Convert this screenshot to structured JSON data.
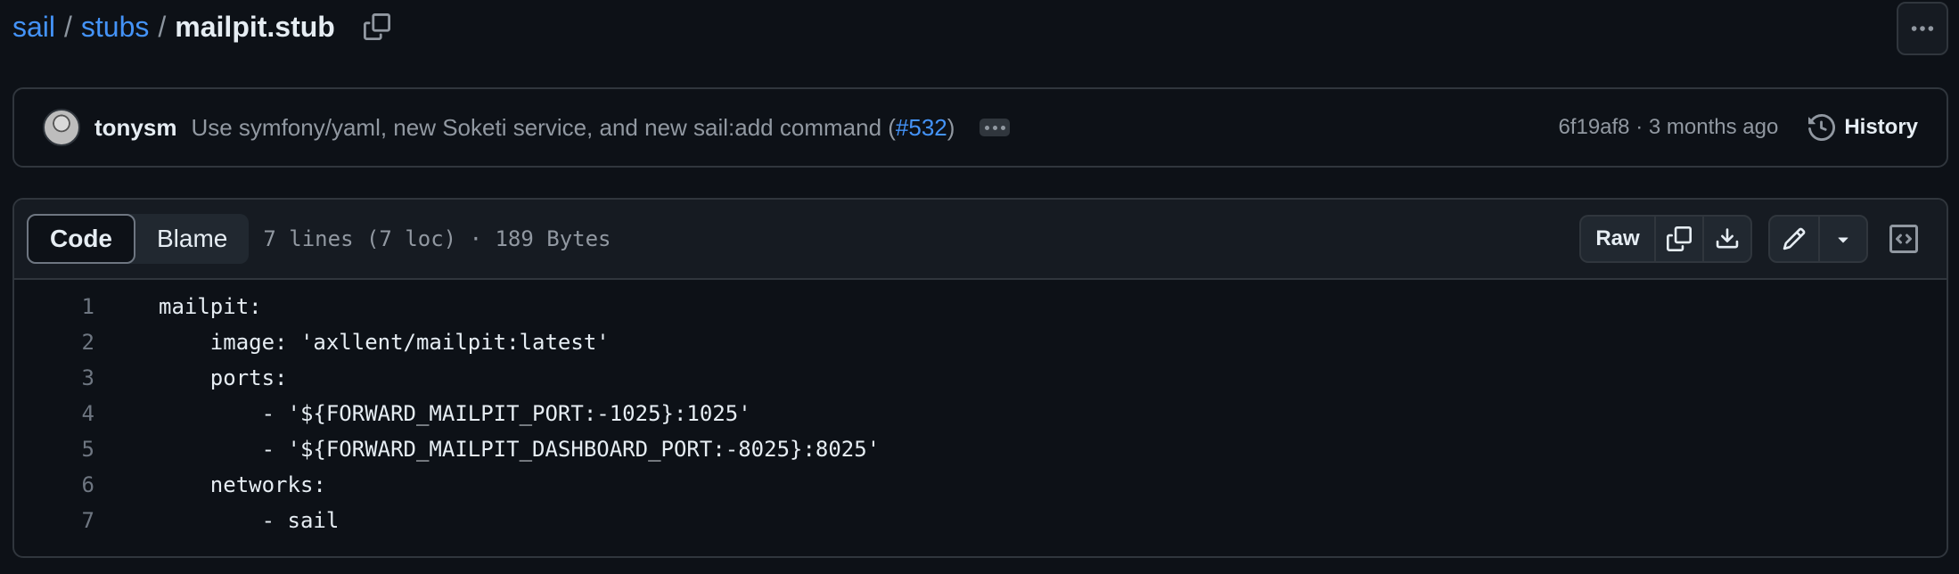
{
  "breadcrumb": {
    "parts": [
      "sail",
      "stubs"
    ],
    "separator": "/",
    "current": "mailpit.stub"
  },
  "commit": {
    "author": "tonysm",
    "message_prefix": "Use symfony/yaml, new Soketi service, and new sail:add command (",
    "pr_number": "#532",
    "message_suffix": ")",
    "sha": "6f19af8",
    "dot": "·",
    "relative_time": "3 months ago",
    "history_label": "History"
  },
  "file_header": {
    "tabs": [
      {
        "label": "Code",
        "active": true
      },
      {
        "label": "Blame",
        "active": false
      }
    ],
    "meta": "7 lines (7 loc) · 189 Bytes",
    "raw_label": "Raw"
  },
  "code": {
    "lines": [
      {
        "number": "1",
        "text": "mailpit:"
      },
      {
        "number": "2",
        "text": "    image: 'axllent/mailpit:latest'"
      },
      {
        "number": "3",
        "text": "    ports:"
      },
      {
        "number": "4",
        "text": "        - '${FORWARD_MAILPIT_PORT:-1025}:1025'"
      },
      {
        "number": "5",
        "text": "        - '${FORWARD_MAILPIT_DASHBOARD_PORT:-8025}:8025'"
      },
      {
        "number": "6",
        "text": "    networks:"
      },
      {
        "number": "7",
        "text": "        - sail"
      }
    ]
  },
  "icons": {
    "copy_path": "copy-icon",
    "more": "kebab-horizontal-icon",
    "history": "history-icon",
    "copy_raw": "copy-icon",
    "download": "download-icon",
    "edit": "pencil-icon",
    "dropdown": "triangle-down-icon",
    "symbols": "code-square-icon"
  },
  "colors": {
    "background": "#0d1117",
    "header_bg": "#161b22",
    "border": "#30363d",
    "link": "#4493f8",
    "text": "#e6edf3",
    "muted": "#9198a1"
  }
}
